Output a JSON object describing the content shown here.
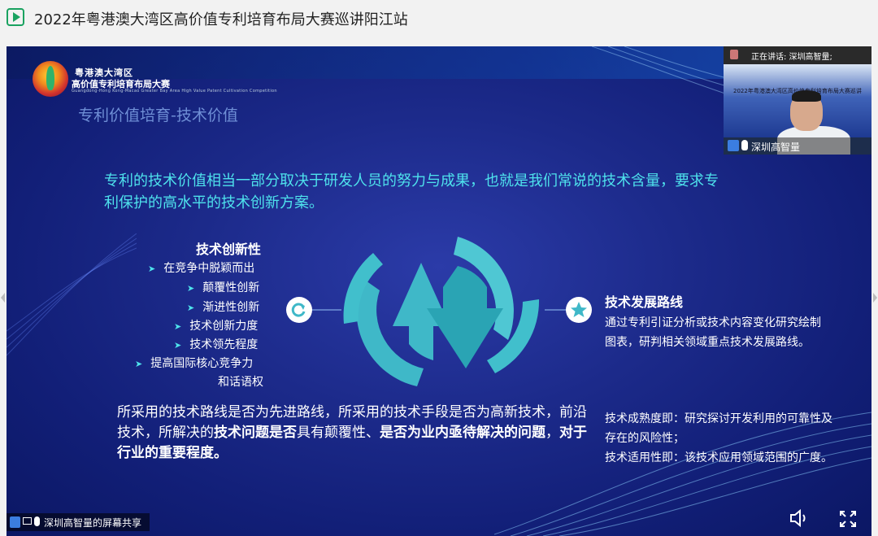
{
  "window": {
    "title": "2022年粤港澳大湾区高价值专利培育布局大赛巡讲阳江站"
  },
  "slide": {
    "org_line1": "粤港澳大湾区",
    "org_line2": "高价值专利培育布局大赛",
    "org_line3": "Guangdong-Hong Kong-Macao Greater Bay Area High Value Patent Cultivation Competition",
    "section_heading": "专利价值培育-技术价值",
    "intro": "专利的技术价值相当一部分取决于研发人员的努力与成果，也就是我们常说的技术含量，要求专利保护的高水平的技术创新方案。",
    "left_heading": "技术创新性",
    "left_items": [
      "在竞争中脱颖而出",
      "颠覆性创新",
      "渐进性创新",
      "技术创新力度",
      "技术领先程度",
      "提高国际核心竞争力",
      "和话语权"
    ],
    "para_part1": "所采用的技术路线是否为先进路线，所采用的技术手段是否为高新技术，前沿技术，所解决的",
    "para_bold1": "技术问题是否",
    "para_part2": "具有颠覆性、",
    "para_bold2": "是否为业内亟待解决的问题",
    "para_part3": "，",
    "para_bold3": "对于行业的重要程度。",
    "right_heading": "技术发展路线",
    "right_desc": "通过专利引证分析或技术内容变化研究绘制图表，研判相关领域重点技术发展路线。",
    "right_desc2_line1": "技术成熟度即：研究探讨开发利用的可靠性及存在的风险性；",
    "right_desc2_line2": "技术适用性即：该技术应用领域范围的广度。",
    "icons": {
      "left": "refresh-icon",
      "right": "star-icon",
      "center": "cycle-arrows-icon"
    },
    "colors": {
      "accent": "#4ee2ec",
      "teal": "#3fb8c8",
      "bg": "#1c2a8a"
    }
  },
  "video_inset": {
    "speaking_label": "正在讲话: 深圳高智量;",
    "inset_slide_title": "2022年粤港澳大湾区高价值专利培育布局大赛巡讲",
    "presenter_name": "深圳高智量"
  },
  "bottom_bar": {
    "share_label": "深圳高智量的屏幕共享"
  }
}
